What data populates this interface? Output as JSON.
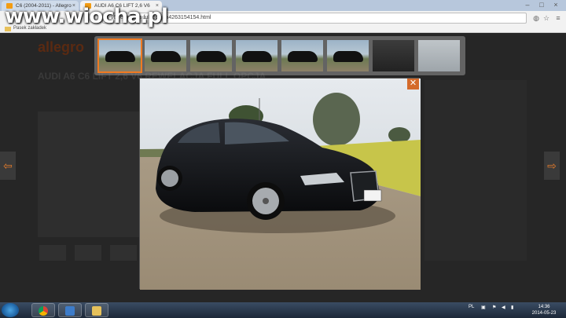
{
  "browser": {
    "tabs": [
      {
        "label": "C6 (2004-2011) - Allegro"
      },
      {
        "label": "AUDI A6 C6 LIFT 2,6 V6"
      }
    ],
    "address": "s-v6-rewelacja-full-opcja-i4263154154.html",
    "bookmarks_label": "Pasek zakładek"
  },
  "page": {
    "logo": "allegro",
    "title": "AUDI A6 C6 LIFT 2,6 V6 REWELACJA FULL OPCJA"
  },
  "watermark": "www.wiocha.pl",
  "gallery": {
    "thumb_count": 8,
    "selected_index": 0,
    "close_label": "✕",
    "prev_label": "⇦",
    "next_label": "⇨"
  },
  "taskbar": {
    "language": "PL",
    "time": "14:36",
    "date": "2014-05-23"
  },
  "colors": {
    "accent": "#f07a21",
    "taskbar": "#1c2838"
  }
}
